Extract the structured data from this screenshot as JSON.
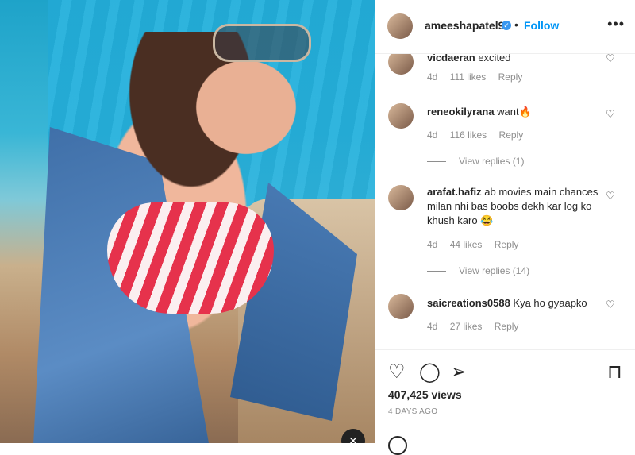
{
  "post": {
    "username": "ameeshapatel9",
    "follow_label": "Follow",
    "separator": "•",
    "more_glyph": "•••",
    "verified_glyph": "✓"
  },
  "comments": [
    {
      "user": "vicdaeran",
      "text": "excited",
      "age": "4d",
      "likes": "111 likes",
      "reply": "Reply"
    },
    {
      "user": "reneokilyrana",
      "text": "want🔥",
      "age": "4d",
      "likes": "116 likes",
      "reply": "Reply",
      "view_replies": "View replies (1)"
    },
    {
      "user": "arafat.hafiz",
      "text": "ab movies main chances milan nhi bas boobs dekh kar log ko khush karo 😂",
      "age": "4d",
      "likes": "44 likes",
      "reply": "Reply",
      "view_replies": "View replies (14)"
    },
    {
      "user": "saicreations0588",
      "text": "Kya ho gyaapko",
      "age": "4d",
      "likes": "27 likes",
      "reply": "Reply"
    }
  ],
  "actions": {
    "like_icon": "heart-outline-icon",
    "comment_icon": "comment-bubble-icon",
    "share_icon": "paper-plane-icon",
    "save_icon": "bookmark-icon",
    "views": "407,425 views",
    "date": "4 DAYS AGO"
  }
}
